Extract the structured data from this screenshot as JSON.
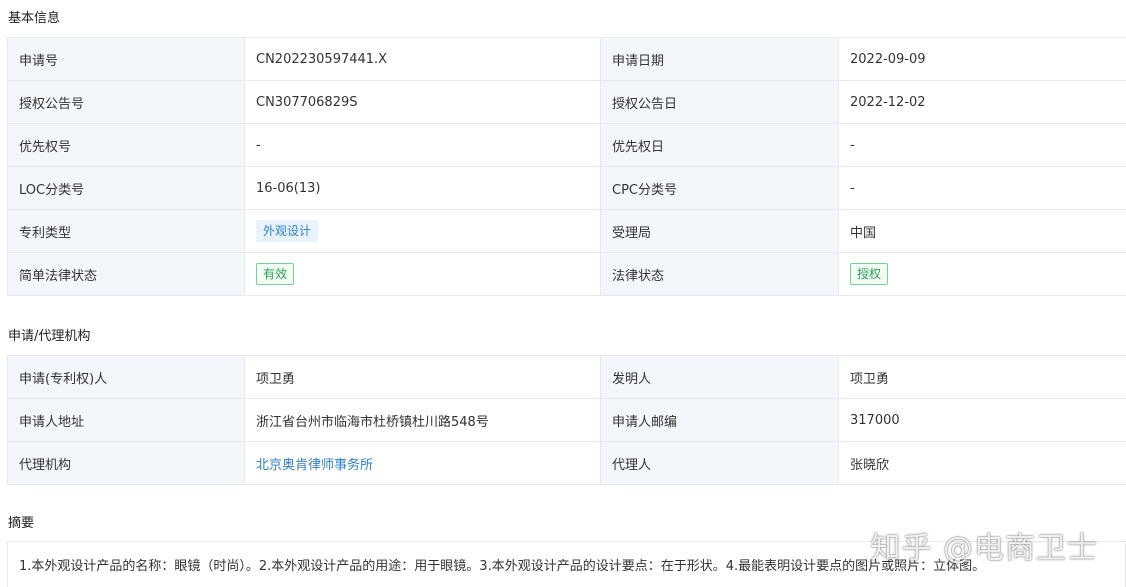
{
  "basic": {
    "title": "基本信息",
    "rows": [
      [
        {
          "label": "申请号",
          "value": "CN202230597441.X"
        },
        {
          "label": "申请日期",
          "value": "2022-09-09"
        }
      ],
      [
        {
          "label": "授权公告号",
          "value": "CN307706829S"
        },
        {
          "label": "授权公告日",
          "value": "2022-12-02"
        }
      ],
      [
        {
          "label": "优先权号",
          "value": "-"
        },
        {
          "label": "优先权日",
          "value": "-"
        }
      ],
      [
        {
          "label": "LOC分类号",
          "value": "16-06(13)"
        },
        {
          "label": "CPC分类号",
          "value": "-"
        }
      ],
      [
        {
          "label": "专利类型",
          "value": "外观设计"
        },
        {
          "label": "受理局",
          "value": "中国"
        }
      ],
      [
        {
          "label": "简单法律状态",
          "value": "有效"
        },
        {
          "label": "法律状态",
          "value": "授权"
        }
      ]
    ]
  },
  "agency": {
    "title": "申请/代理机构",
    "rows": [
      [
        {
          "label": "申请(专利权)人",
          "value": "项卫勇"
        },
        {
          "label": "发明人",
          "value": "项卫勇"
        }
      ],
      [
        {
          "label": "申请人地址",
          "value": "浙江省台州市临海市杜桥镇杜川路548号"
        },
        {
          "label": "申请人邮编",
          "value": "317000"
        }
      ],
      [
        {
          "label": "代理机构",
          "value": "北京奥肯律师事务所"
        },
        {
          "label": "代理人",
          "value": "张晓欣"
        }
      ]
    ]
  },
  "abstract": {
    "title": "摘要",
    "text": "1.本外观设计产品的名称：眼镜（时尚）。2.本外观设计产品的用途：用于眼镜。3.本外观设计产品的设计要点：在于形状。4.最能表明设计要点的图片或照片：立体图。"
  },
  "watermark": "知乎 @电商卫士",
  "colors": {
    "label_bg": "#f3f6fa",
    "link": "#2f7fd0",
    "tag_green": "#2ea05a"
  }
}
